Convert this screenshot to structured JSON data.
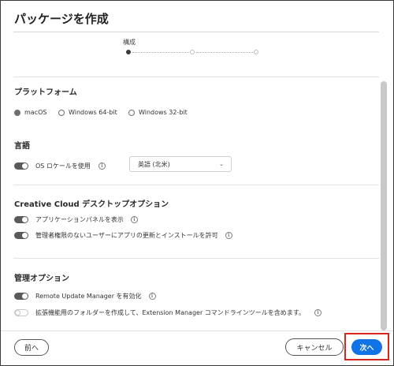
{
  "dialog": {
    "title": "パッケージを作成"
  },
  "steps": {
    "current_label": "構成",
    "count": 3,
    "current_index": 0
  },
  "platform": {
    "title": "プラットフォーム",
    "options": [
      {
        "label": "macOS",
        "checked": true
      },
      {
        "label": "Windows 64-bit",
        "checked": false
      },
      {
        "label": "Windows 32-bit",
        "checked": false
      }
    ]
  },
  "language": {
    "title": "言語",
    "os_locale_label": "OS ロケールを使用",
    "os_locale_on": true,
    "select_value": "英語 (北米)"
  },
  "cc_desktop": {
    "title": "Creative Cloud デスクトップオプション",
    "items": [
      {
        "label": "アプリケーションパネルを表示",
        "on": true
      },
      {
        "label": "管理者権限のないユーザーにアプリの更新とインストールを許可",
        "on": true
      }
    ]
  },
  "management": {
    "title": "管理オプション",
    "items": [
      {
        "label": "Remote Update Manager を有効化",
        "on": true
      },
      {
        "label": "拡張機能用のフォルダーを作成して、Extension Manager コマンドラインツールを含めます。",
        "on": false
      }
    ]
  },
  "footer": {
    "prev_label": "前へ",
    "cancel_label": "キャンセル",
    "next_label": "次へ"
  },
  "colors": {
    "primary": "#1273e6",
    "highlight": "#d9261c",
    "toggle_on": "#5a5a5a"
  },
  "icons": {
    "info": "info-icon",
    "chevron": "chevron-down-icon"
  }
}
